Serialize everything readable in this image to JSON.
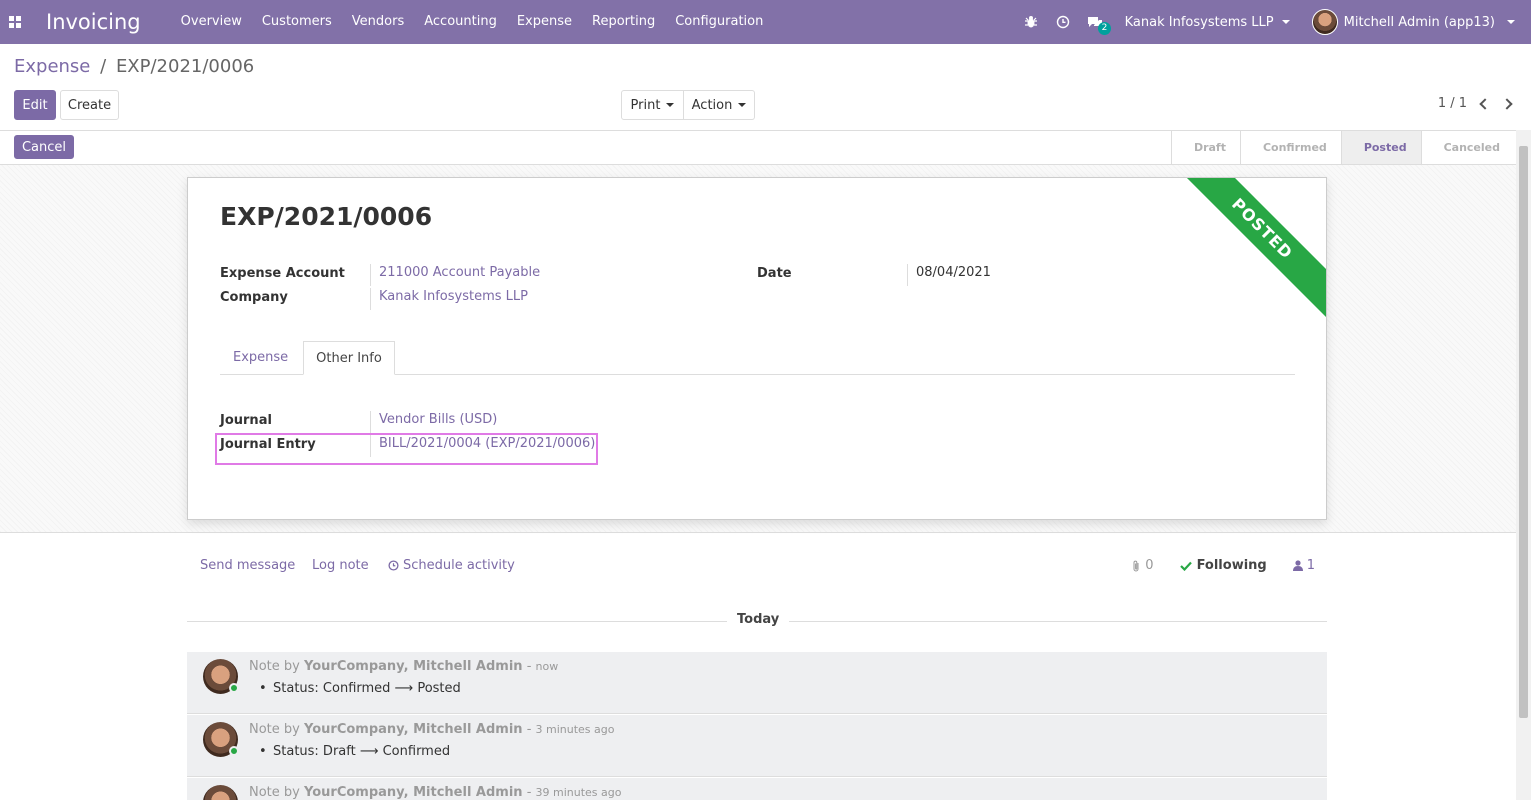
{
  "navbar": {
    "app_title": "Invoicing",
    "menu": [
      "Overview",
      "Customers",
      "Vendors",
      "Accounting",
      "Expense",
      "Reporting",
      "Configuration"
    ],
    "message_count": "2",
    "company": "Kanak Infosystems LLP",
    "user": "Mitchell Admin (app13)",
    "icons": [
      "apps-icon",
      "bug-icon",
      "clock-icon",
      "chat-icon"
    ]
  },
  "control": {
    "breadcrumb_parent": "Expense",
    "breadcrumb_sep": "/",
    "breadcrumb_current": "EXP/2021/0006",
    "edit_label": "Edit",
    "create_label": "Create",
    "print_label": "Print",
    "action_label": "Action",
    "pager": "1 / 1"
  },
  "status": {
    "cancel_label": "Cancel",
    "stages": [
      "Draft",
      "Confirmed",
      "Posted",
      "Canceled"
    ],
    "active_stage": "Posted"
  },
  "form": {
    "ribbon": "POSTED",
    "title": "EXP/2021/0006",
    "expense_account_label": "Expense Account",
    "expense_account_value": "211000 Account Payable",
    "company_label": "Company",
    "company_value": "Kanak Infosystems LLP",
    "date_label": "Date",
    "date_value": "08/04/2021",
    "tabs": [
      "Expense",
      "Other Info"
    ],
    "active_tab": "Other Info",
    "journal_label": "Journal",
    "journal_value": "Vendor Bills (USD)",
    "journal_entry_label": "Journal Entry",
    "journal_entry_value": "BILL/2021/0004 (EXP/2021/0006)"
  },
  "chatter": {
    "send_message": "Send message",
    "log_note": "Log note",
    "schedule_activity": "Schedule activity",
    "attachments": "0",
    "following": "Following",
    "followers": "1",
    "today": "Today",
    "messages": [
      {
        "prefix": "Note by",
        "author": "YourCompany, Mitchell Admin",
        "time": "now",
        "body": "Status: Confirmed ⟶ Posted"
      },
      {
        "prefix": "Note by",
        "author": "YourCompany, Mitchell Admin",
        "time": "3 minutes ago",
        "body": "Status: Draft ⟶ Confirmed"
      },
      {
        "prefix": "Note by",
        "author": "YourCompany, Mitchell Admin",
        "time": "39 minutes ago",
        "body": ""
      }
    ]
  },
  "colors": {
    "navbar": "#8271a8",
    "primary": "#7c6aa6",
    "ribbon": "#28a745",
    "highlight": "#e07ae6"
  }
}
